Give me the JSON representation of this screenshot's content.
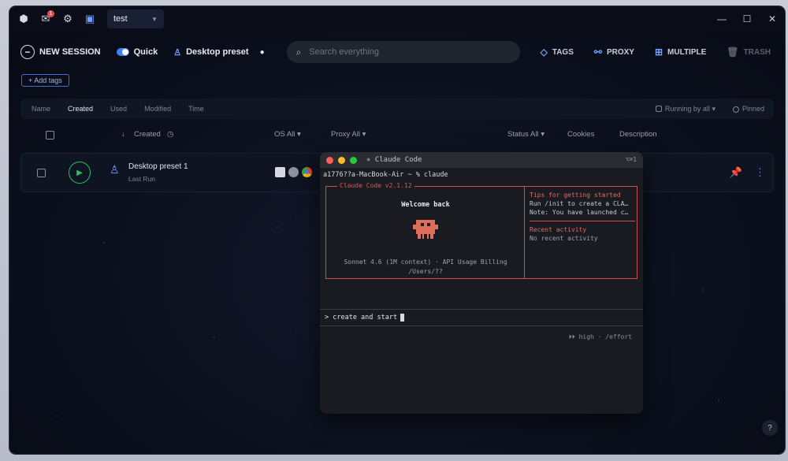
{
  "titlebar": {
    "notification_count": "1",
    "tab_label": "test"
  },
  "toolbar": {
    "new_session": "NEW SESSION",
    "quick": "Quick",
    "preset": "Desktop preset",
    "search_placeholder": "Search everything",
    "tags": "TAGS",
    "proxy": "PROXY",
    "multiple": "MULTIPLE",
    "trash": "TRASH"
  },
  "add_tags": "+ Add tags",
  "sortbar": {
    "items": [
      "Name",
      "Created",
      "Used",
      "Modified",
      "Time"
    ],
    "running_by_all": "Running by all",
    "pinned": "Pinned"
  },
  "table_header": {
    "created": "Created",
    "os": "OS All",
    "proxy": "Proxy All",
    "status": "Status All",
    "cookies": "Cookies",
    "description": "Description"
  },
  "row": {
    "name": "Desktop preset 1",
    "sub": "Last Run"
  },
  "terminal": {
    "title": "✳ Claude Code",
    "shortcut": "⌥⌘1",
    "prompt": "a1776??a-MacBook-Air ~ % claude",
    "box_title": "Claude Code v2.1.12",
    "welcome": "Welcome back",
    "model_line1": "Sonnet 4.6 (1M context) · API Usage Billing",
    "model_line2": "/Users/??",
    "tips_heading": "Tips for getting started",
    "tips_line1": "Run /init to create a CLA…",
    "tips_line2": "Note: You have launched c…",
    "recent_heading": "Recent activity",
    "recent_line": "No recent activity",
    "input": "> create and start",
    "hint": "⏵⏵ high · /effort"
  },
  "colors": {
    "accent": "#3b82f6",
    "play": "#22c55e",
    "terminal_accent": "#c9524f"
  }
}
